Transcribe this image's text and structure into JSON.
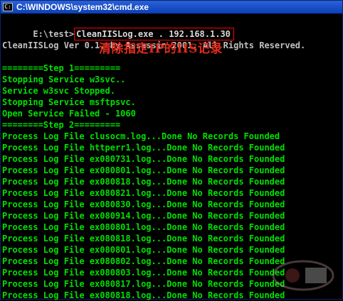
{
  "window": {
    "title": "C:\\WINDOWS\\system32\\cmd.exe"
  },
  "console": {
    "prompt": "E:\\test>",
    "command": "CleanIISLog.exe . 192.168.1.30",
    "annotation": "清除指定IP的IIS记录",
    "lines": [
      "CleanIISLog Ver 0.1, by Assassin 2001. All Rights Reserved.",
      "========Step 1=========",
      "Stopping Service w3svc..",
      "Service w3svc Stopped.",
      "Stopping Service msftpsvc.",
      "Open Service Failed - 1060",
      "========Step 2=========",
      "Process Log File clusocm.log...Done No Records Founded",
      "Process Log File httperr1.log...Done No Records Founded",
      "Process Log File ex080731.log...Done No Records Founded",
      "Process Log File ex080801.log...Done No Records Founded",
      "Process Log File ex080818.log...Done No Records Founded",
      "Process Log File ex080821.log...Done No Records Founded",
      "Process Log File ex080830.log...Done No Records Founded",
      "Process Log File ex080914.log...Done No Records Founded",
      "Process Log File ex080801.log...Done No Records Founded",
      "Process Log File ex080818.log...Done No Records Founded",
      "Process Log File ex080801.log...Done No Records Founded",
      "Process Log File ex080802.log...Done No Records Founded",
      "Process Log File ex080803.log...Done No Records Founded",
      "Process Log File ex080817.log...Done No Records Founded",
      "Process Log File ex080818.log...Done No Records Founded"
    ]
  },
  "colors": {
    "text": "#c0c0c0",
    "log_text": "#00e000",
    "annotation": "#e4291c",
    "highlight_box": "#ff0000",
    "titlebar": "#0b3fb8"
  }
}
